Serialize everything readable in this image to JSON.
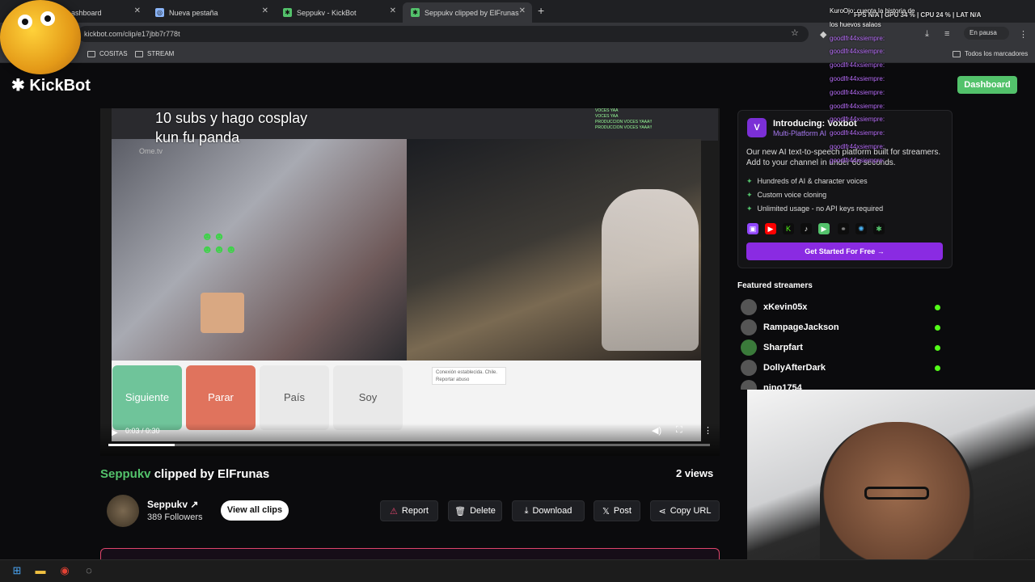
{
  "browser": {
    "tabs": [
      {
        "title": "ashboard"
      },
      {
        "title": "Nueva pestaña"
      },
      {
        "title": "Seppukv - KickBot"
      },
      {
        "title": "Seppukv clipped by ElFrunas"
      }
    ],
    "url": "kickbot.com/clip/e17jbb7r778t",
    "pause_label": "En pausa",
    "bookmarks": [
      "COSITAS",
      "STREAM"
    ],
    "all_bookmarks": "Todos los marcadores"
  },
  "site": {
    "logo": "KickBot",
    "dashboard_label": "Dashboard"
  },
  "video": {
    "overlay_caption_line1": "10 subs y hago cosplay",
    "overlay_caption_line2": "kun fu panda",
    "ome_logo": "Ome.tv",
    "ome_buttons": {
      "siguiente": "Siguiente",
      "parar": "Parar",
      "pais": "País",
      "soy": "Soy"
    },
    "ome_message": "Conexión establecida. Chile. Reportar abuso",
    "time": "0:03 / 0:30",
    "progress": 0.11,
    "buffered": 0.55
  },
  "clip": {
    "streamer": "Seppukv",
    "title_rest": " clipped by ElFrunas",
    "views": "2 views",
    "channel_name": "Seppukv",
    "followers": "389 Followers",
    "view_all": "View all clips",
    "actions": {
      "report": "Report",
      "delete": "Delete",
      "download": "Download",
      "post": "Post",
      "copy_url": "Copy URL"
    }
  },
  "promo": {
    "title": "Introducing: Voxbot",
    "subtitle": "Multi-Platform AI",
    "text": "Our new AI text-to-speech platform built for streamers. Add to your channel in under 60 seconds.",
    "features": [
      "Hundreds of AI & character voices",
      "Custom voice cloning",
      "Unlimited usage - no API keys required"
    ],
    "cta": "Get Started For Free →"
  },
  "featured": {
    "heading": "Featured streamers",
    "streamers": [
      {
        "name": "xKevin05x"
      },
      {
        "name": "RampageJackson"
      },
      {
        "name": "Sharpfart"
      },
      {
        "name": "DollyAfterDark"
      },
      {
        "name": "nino1754"
      }
    ]
  },
  "overlay": {
    "stats": "FPS N/A | GPU 34 % | CPU 24 % | LAT N/A",
    "chat": [
      "KuroOjo: cuenta la historia de los huevos salaos",
      "goodlfr44xsiempre:",
      "goodlfr44xsiempre:",
      "goodlfr44xsiempre:",
      "goodlfr44xsiempre:",
      "goodlfr44xsiempre:",
      "goodlfr44xsiempre:",
      "goodlfr44xsiempre:",
      "goodlfr44xsiempre:",
      "goodlfr44xsiempre:",
      "goodlfr44xsiempre:"
    ]
  },
  "colors": {
    "kick_green": "#53c26b",
    "voxbot_purple": "#8a2be2",
    "report_red": "#e0456c"
  }
}
